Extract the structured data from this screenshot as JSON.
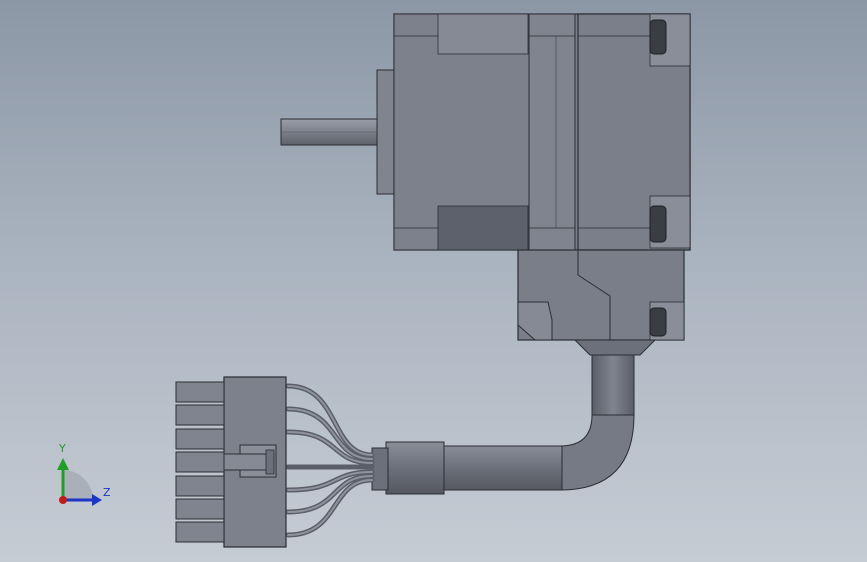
{
  "viewport": {
    "colors": {
      "background_top": "#8c97a6",
      "background_bottom": "#c6ccd4",
      "model_light": "#80848f",
      "model_mid": "#6f737e",
      "model_dark": "#5a5e68",
      "edge": "#2b2d33"
    }
  },
  "triad": {
    "x_label": "",
    "y_label": "Y",
    "z_label": "Z",
    "y_color": "#1f9e2a",
    "z_color": "#1b35c9",
    "x_color": "#c41a1a"
  }
}
